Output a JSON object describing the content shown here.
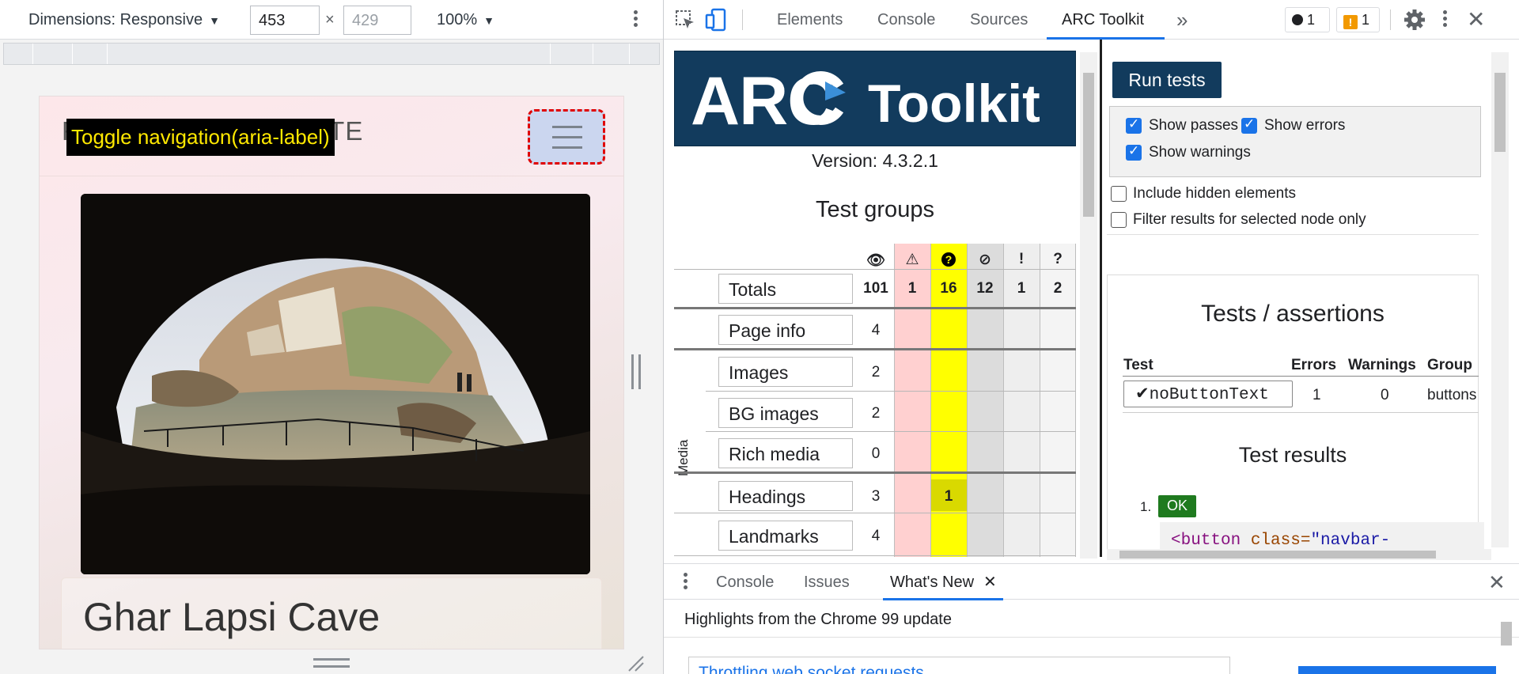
{
  "device_toolbar": {
    "dimensions_label": "Dimensions: Responsive",
    "width_value": "453",
    "height_placeholder": "429",
    "times": "×",
    "zoom": "100%"
  },
  "site": {
    "brand_visible_left": "F",
    "brand_visible_right": "TE",
    "tooltip": "Toggle navigation(aria-label)",
    "card_title": "Ghar Lapsi Cave"
  },
  "devtools": {
    "tabs": [
      "Elements",
      "Console",
      "Sources",
      "ARC Toolkit"
    ],
    "active_tab": "ARC Toolkit",
    "more_tabs": "»",
    "error_count": "1",
    "warning_count": "1"
  },
  "arc": {
    "logo_arc": "ARC",
    "logo_toolkit": "Toolkit",
    "version": "Version: 4.3.2.1",
    "groups_title": "Test groups",
    "header_icons": [
      "👁",
      "⚠",
      "?",
      "⊘",
      "!",
      "?"
    ],
    "media_label": "Media",
    "rows": [
      {
        "label": "Totals",
        "values": [
          "101",
          "1",
          "16",
          "12",
          "1",
          "2"
        ]
      },
      {
        "label": "Page info",
        "values": [
          "4",
          "",
          "",
          "",
          "",
          ""
        ]
      },
      {
        "label": "Images",
        "values": [
          "2",
          "",
          "",
          "",
          "",
          ""
        ]
      },
      {
        "label": "BG images",
        "values": [
          "2",
          "",
          "",
          "",
          "",
          ""
        ]
      },
      {
        "label": "Rich media",
        "values": [
          "0",
          "",
          "",
          "",
          "",
          ""
        ]
      },
      {
        "label": "Headings",
        "values": [
          "3",
          "",
          "1",
          "",
          "",
          ""
        ]
      },
      {
        "label": "Landmarks",
        "values": [
          "4",
          "",
          "",
          "",
          "",
          ""
        ]
      }
    ],
    "run_button": "Run tests",
    "options": {
      "show_passes": "Show passes",
      "show_errors": "Show errors",
      "show_warnings": "Show warnings",
      "include_hidden": "Include hidden elements",
      "filter_selected": "Filter results for selected node only"
    },
    "assertions_title": "Tests / assertions",
    "table_headers": [
      "Test",
      "Errors",
      "Warnings",
      "Group"
    ],
    "test_row": {
      "test": "noButtonText",
      "errors": "1",
      "warnings": "0",
      "group": "buttons"
    },
    "results_title": "Test results",
    "result_number": "1.",
    "result_badge": "OK",
    "code_tag": "<button",
    "code_attr": "class=",
    "code_val": "\"navbar-"
  },
  "drawer": {
    "tabs": [
      "Console",
      "Issues",
      "What's New"
    ],
    "active_tab": "What's New",
    "highlight": "Highlights from the Chrome 99 update",
    "news_link": "Throttling web socket requests"
  },
  "colors": {
    "arc_navy": "#123b5d",
    "accent_blue": "#1a73e8",
    "warning_yellow": "#ffff00",
    "error_pink": "#ffd0d0"
  }
}
